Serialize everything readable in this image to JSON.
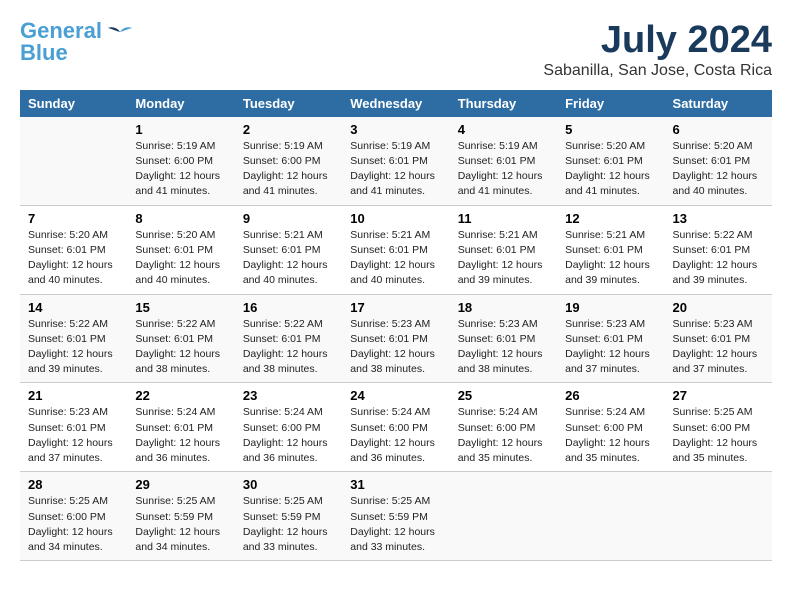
{
  "logo": {
    "line1": "General",
    "line2": "Blue"
  },
  "title": "July 2024",
  "location": "Sabanilla, San Jose, Costa Rica",
  "days_header": [
    "Sunday",
    "Monday",
    "Tuesday",
    "Wednesday",
    "Thursday",
    "Friday",
    "Saturday"
  ],
  "weeks": [
    [
      {
        "num": "",
        "info": ""
      },
      {
        "num": "1",
        "info": "Sunrise: 5:19 AM\nSunset: 6:00 PM\nDaylight: 12 hours\nand 41 minutes."
      },
      {
        "num": "2",
        "info": "Sunrise: 5:19 AM\nSunset: 6:00 PM\nDaylight: 12 hours\nand 41 minutes."
      },
      {
        "num": "3",
        "info": "Sunrise: 5:19 AM\nSunset: 6:01 PM\nDaylight: 12 hours\nand 41 minutes."
      },
      {
        "num": "4",
        "info": "Sunrise: 5:19 AM\nSunset: 6:01 PM\nDaylight: 12 hours\nand 41 minutes."
      },
      {
        "num": "5",
        "info": "Sunrise: 5:20 AM\nSunset: 6:01 PM\nDaylight: 12 hours\nand 41 minutes."
      },
      {
        "num": "6",
        "info": "Sunrise: 5:20 AM\nSunset: 6:01 PM\nDaylight: 12 hours\nand 40 minutes."
      }
    ],
    [
      {
        "num": "7",
        "info": "Sunrise: 5:20 AM\nSunset: 6:01 PM\nDaylight: 12 hours\nand 40 minutes."
      },
      {
        "num": "8",
        "info": "Sunrise: 5:20 AM\nSunset: 6:01 PM\nDaylight: 12 hours\nand 40 minutes."
      },
      {
        "num": "9",
        "info": "Sunrise: 5:21 AM\nSunset: 6:01 PM\nDaylight: 12 hours\nand 40 minutes."
      },
      {
        "num": "10",
        "info": "Sunrise: 5:21 AM\nSunset: 6:01 PM\nDaylight: 12 hours\nand 40 minutes."
      },
      {
        "num": "11",
        "info": "Sunrise: 5:21 AM\nSunset: 6:01 PM\nDaylight: 12 hours\nand 39 minutes."
      },
      {
        "num": "12",
        "info": "Sunrise: 5:21 AM\nSunset: 6:01 PM\nDaylight: 12 hours\nand 39 minutes."
      },
      {
        "num": "13",
        "info": "Sunrise: 5:22 AM\nSunset: 6:01 PM\nDaylight: 12 hours\nand 39 minutes."
      }
    ],
    [
      {
        "num": "14",
        "info": "Sunrise: 5:22 AM\nSunset: 6:01 PM\nDaylight: 12 hours\nand 39 minutes."
      },
      {
        "num": "15",
        "info": "Sunrise: 5:22 AM\nSunset: 6:01 PM\nDaylight: 12 hours\nand 38 minutes."
      },
      {
        "num": "16",
        "info": "Sunrise: 5:22 AM\nSunset: 6:01 PM\nDaylight: 12 hours\nand 38 minutes."
      },
      {
        "num": "17",
        "info": "Sunrise: 5:23 AM\nSunset: 6:01 PM\nDaylight: 12 hours\nand 38 minutes."
      },
      {
        "num": "18",
        "info": "Sunrise: 5:23 AM\nSunset: 6:01 PM\nDaylight: 12 hours\nand 38 minutes."
      },
      {
        "num": "19",
        "info": "Sunrise: 5:23 AM\nSunset: 6:01 PM\nDaylight: 12 hours\nand 37 minutes."
      },
      {
        "num": "20",
        "info": "Sunrise: 5:23 AM\nSunset: 6:01 PM\nDaylight: 12 hours\nand 37 minutes."
      }
    ],
    [
      {
        "num": "21",
        "info": "Sunrise: 5:23 AM\nSunset: 6:01 PM\nDaylight: 12 hours\nand 37 minutes."
      },
      {
        "num": "22",
        "info": "Sunrise: 5:24 AM\nSunset: 6:01 PM\nDaylight: 12 hours\nand 36 minutes."
      },
      {
        "num": "23",
        "info": "Sunrise: 5:24 AM\nSunset: 6:00 PM\nDaylight: 12 hours\nand 36 minutes."
      },
      {
        "num": "24",
        "info": "Sunrise: 5:24 AM\nSunset: 6:00 PM\nDaylight: 12 hours\nand 36 minutes."
      },
      {
        "num": "25",
        "info": "Sunrise: 5:24 AM\nSunset: 6:00 PM\nDaylight: 12 hours\nand 35 minutes."
      },
      {
        "num": "26",
        "info": "Sunrise: 5:24 AM\nSunset: 6:00 PM\nDaylight: 12 hours\nand 35 minutes."
      },
      {
        "num": "27",
        "info": "Sunrise: 5:25 AM\nSunset: 6:00 PM\nDaylight: 12 hours\nand 35 minutes."
      }
    ],
    [
      {
        "num": "28",
        "info": "Sunrise: 5:25 AM\nSunset: 6:00 PM\nDaylight: 12 hours\nand 34 minutes."
      },
      {
        "num": "29",
        "info": "Sunrise: 5:25 AM\nSunset: 5:59 PM\nDaylight: 12 hours\nand 34 minutes."
      },
      {
        "num": "30",
        "info": "Sunrise: 5:25 AM\nSunset: 5:59 PM\nDaylight: 12 hours\nand 33 minutes."
      },
      {
        "num": "31",
        "info": "Sunrise: 5:25 AM\nSunset: 5:59 PM\nDaylight: 12 hours\nand 33 minutes."
      },
      {
        "num": "",
        "info": ""
      },
      {
        "num": "",
        "info": ""
      },
      {
        "num": "",
        "info": ""
      }
    ]
  ]
}
